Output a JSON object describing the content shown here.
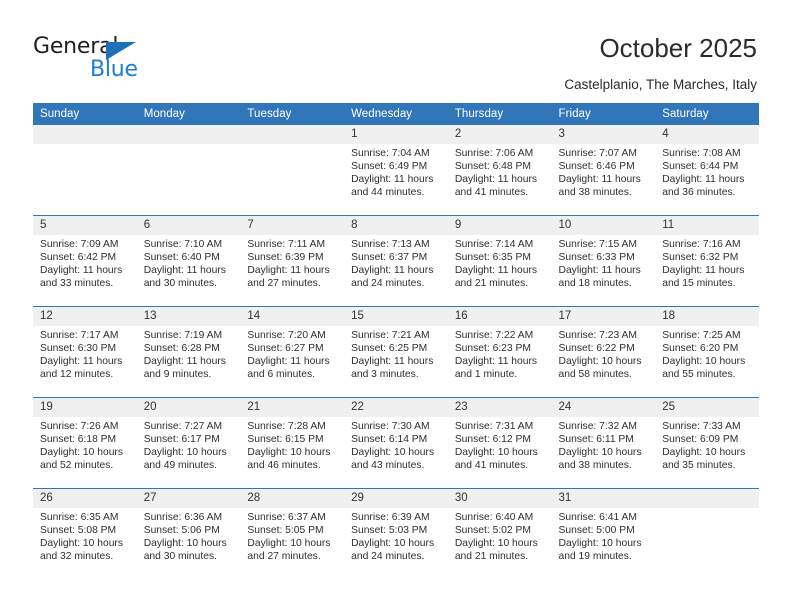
{
  "brand": {
    "line1": "General",
    "line2": "Blue",
    "triangle_color": "#1d71b8",
    "line2_color": "#1b7fd4"
  },
  "header": {
    "title": "October 2025",
    "subtitle": "Castelplanio, The Marches, Italy"
  },
  "theme": {
    "header_blue": "#3176b8",
    "daynum_bg": "#f0f0f0",
    "page_bg": "#ffffff"
  },
  "calendar": {
    "weekday_headers": [
      "Sunday",
      "Monday",
      "Tuesday",
      "Wednesday",
      "Thursday",
      "Friday",
      "Saturday"
    ],
    "labels": {
      "sunrise": "Sunrise:",
      "sunset": "Sunset:",
      "daylight": "Daylight:"
    },
    "weeks": [
      [
        {
          "day": "",
          "empty": true
        },
        {
          "day": "",
          "empty": true
        },
        {
          "day": "",
          "empty": true
        },
        {
          "day": "1",
          "sunrise": "Sunrise: 7:04 AM",
          "sunset": "Sunset: 6:49 PM",
          "daylight": "Daylight: 11 hours and 44 minutes."
        },
        {
          "day": "2",
          "sunrise": "Sunrise: 7:06 AM",
          "sunset": "Sunset: 6:48 PM",
          "daylight": "Daylight: 11 hours and 41 minutes."
        },
        {
          "day": "3",
          "sunrise": "Sunrise: 7:07 AM",
          "sunset": "Sunset: 6:46 PM",
          "daylight": "Daylight: 11 hours and 38 minutes."
        },
        {
          "day": "4",
          "sunrise": "Sunrise: 7:08 AM",
          "sunset": "Sunset: 6:44 PM",
          "daylight": "Daylight: 11 hours and 36 minutes."
        }
      ],
      [
        {
          "day": "5",
          "sunrise": "Sunrise: 7:09 AM",
          "sunset": "Sunset: 6:42 PM",
          "daylight": "Daylight: 11 hours and 33 minutes."
        },
        {
          "day": "6",
          "sunrise": "Sunrise: 7:10 AM",
          "sunset": "Sunset: 6:40 PM",
          "daylight": "Daylight: 11 hours and 30 minutes."
        },
        {
          "day": "7",
          "sunrise": "Sunrise: 7:11 AM",
          "sunset": "Sunset: 6:39 PM",
          "daylight": "Daylight: 11 hours and 27 minutes."
        },
        {
          "day": "8",
          "sunrise": "Sunrise: 7:13 AM",
          "sunset": "Sunset: 6:37 PM",
          "daylight": "Daylight: 11 hours and 24 minutes."
        },
        {
          "day": "9",
          "sunrise": "Sunrise: 7:14 AM",
          "sunset": "Sunset: 6:35 PM",
          "daylight": "Daylight: 11 hours and 21 minutes."
        },
        {
          "day": "10",
          "sunrise": "Sunrise: 7:15 AM",
          "sunset": "Sunset: 6:33 PM",
          "daylight": "Daylight: 11 hours and 18 minutes."
        },
        {
          "day": "11",
          "sunrise": "Sunrise: 7:16 AM",
          "sunset": "Sunset: 6:32 PM",
          "daylight": "Daylight: 11 hours and 15 minutes."
        }
      ],
      [
        {
          "day": "12",
          "sunrise": "Sunrise: 7:17 AM",
          "sunset": "Sunset: 6:30 PM",
          "daylight": "Daylight: 11 hours and 12 minutes."
        },
        {
          "day": "13",
          "sunrise": "Sunrise: 7:19 AM",
          "sunset": "Sunset: 6:28 PM",
          "daylight": "Daylight: 11 hours and 9 minutes."
        },
        {
          "day": "14",
          "sunrise": "Sunrise: 7:20 AM",
          "sunset": "Sunset: 6:27 PM",
          "daylight": "Daylight: 11 hours and 6 minutes."
        },
        {
          "day": "15",
          "sunrise": "Sunrise: 7:21 AM",
          "sunset": "Sunset: 6:25 PM",
          "daylight": "Daylight: 11 hours and 3 minutes."
        },
        {
          "day": "16",
          "sunrise": "Sunrise: 7:22 AM",
          "sunset": "Sunset: 6:23 PM",
          "daylight": "Daylight: 11 hours and 1 minute."
        },
        {
          "day": "17",
          "sunrise": "Sunrise: 7:23 AM",
          "sunset": "Sunset: 6:22 PM",
          "daylight": "Daylight: 10 hours and 58 minutes."
        },
        {
          "day": "18",
          "sunrise": "Sunrise: 7:25 AM",
          "sunset": "Sunset: 6:20 PM",
          "daylight": "Daylight: 10 hours and 55 minutes."
        }
      ],
      [
        {
          "day": "19",
          "sunrise": "Sunrise: 7:26 AM",
          "sunset": "Sunset: 6:18 PM",
          "daylight": "Daylight: 10 hours and 52 minutes."
        },
        {
          "day": "20",
          "sunrise": "Sunrise: 7:27 AM",
          "sunset": "Sunset: 6:17 PM",
          "daylight": "Daylight: 10 hours and 49 minutes."
        },
        {
          "day": "21",
          "sunrise": "Sunrise: 7:28 AM",
          "sunset": "Sunset: 6:15 PM",
          "daylight": "Daylight: 10 hours and 46 minutes."
        },
        {
          "day": "22",
          "sunrise": "Sunrise: 7:30 AM",
          "sunset": "Sunset: 6:14 PM",
          "daylight": "Daylight: 10 hours and 43 minutes."
        },
        {
          "day": "23",
          "sunrise": "Sunrise: 7:31 AM",
          "sunset": "Sunset: 6:12 PM",
          "daylight": "Daylight: 10 hours and 41 minutes."
        },
        {
          "day": "24",
          "sunrise": "Sunrise: 7:32 AM",
          "sunset": "Sunset: 6:11 PM",
          "daylight": "Daylight: 10 hours and 38 minutes."
        },
        {
          "day": "25",
          "sunrise": "Sunrise: 7:33 AM",
          "sunset": "Sunset: 6:09 PM",
          "daylight": "Daylight: 10 hours and 35 minutes."
        }
      ],
      [
        {
          "day": "26",
          "sunrise": "Sunrise: 6:35 AM",
          "sunset": "Sunset: 5:08 PM",
          "daylight": "Daylight: 10 hours and 32 minutes."
        },
        {
          "day": "27",
          "sunrise": "Sunrise: 6:36 AM",
          "sunset": "Sunset: 5:06 PM",
          "daylight": "Daylight: 10 hours and 30 minutes."
        },
        {
          "day": "28",
          "sunrise": "Sunrise: 6:37 AM",
          "sunset": "Sunset: 5:05 PM",
          "daylight": "Daylight: 10 hours and 27 minutes."
        },
        {
          "day": "29",
          "sunrise": "Sunrise: 6:39 AM",
          "sunset": "Sunset: 5:03 PM",
          "daylight": "Daylight: 10 hours and 24 minutes."
        },
        {
          "day": "30",
          "sunrise": "Sunrise: 6:40 AM",
          "sunset": "Sunset: 5:02 PM",
          "daylight": "Daylight: 10 hours and 21 minutes."
        },
        {
          "day": "31",
          "sunrise": "Sunrise: 6:41 AM",
          "sunset": "Sunset: 5:00 PM",
          "daylight": "Daylight: 10 hours and 19 minutes."
        },
        {
          "day": "",
          "empty": true
        }
      ]
    ]
  }
}
